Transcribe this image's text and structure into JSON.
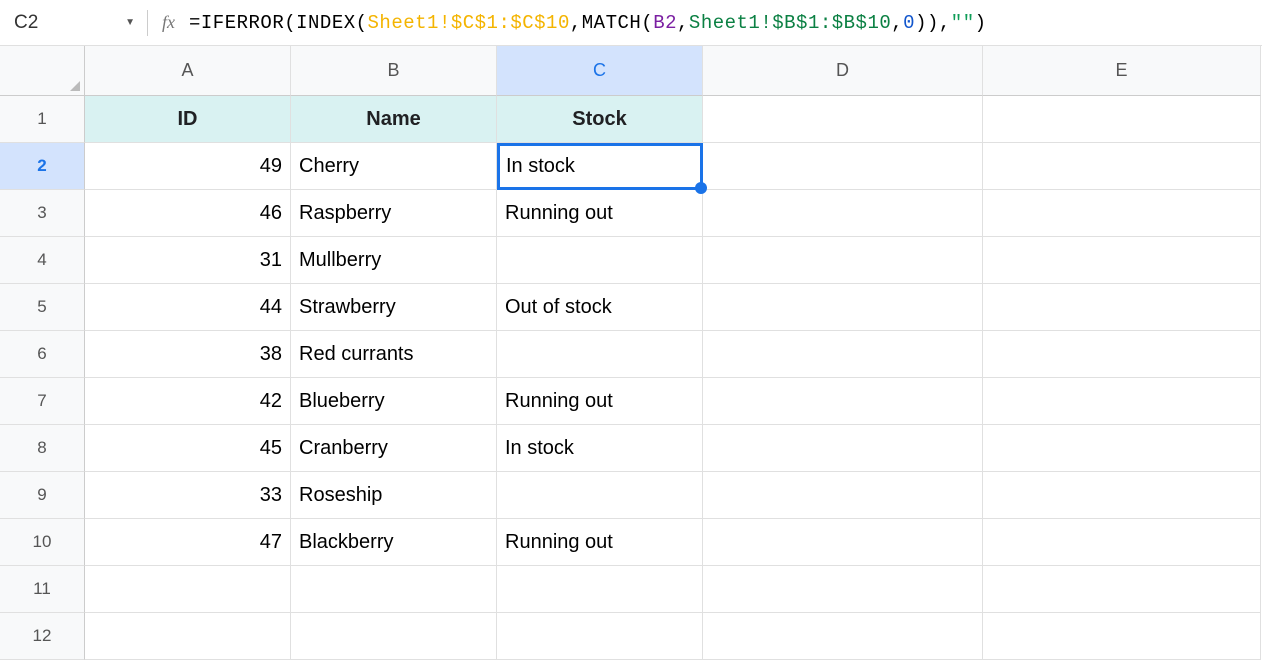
{
  "nameBox": "C2",
  "formula": {
    "prefix": "=IFERROR(INDEX(",
    "range1": "Sheet1!$C$1:$C$10",
    "mid1": ",MATCH(",
    "ref": "B2",
    "mid2": ",",
    "range2": "Sheet1!$B$1:$B$10",
    "mid3": ",",
    "zero": "0",
    "mid4": ")),",
    "quotes": "\"\"",
    "end": ")"
  },
  "columns": [
    "A",
    "B",
    "C",
    "D",
    "E"
  ],
  "selectedColumn": "C",
  "selectedRow": 2,
  "headerRow": [
    "ID",
    "Name",
    "Stock"
  ],
  "rows": [
    {
      "num": 1,
      "A": "ID",
      "B": "Name",
      "C": "Stock",
      "header": true
    },
    {
      "num": 2,
      "A": "49",
      "B": "Cherry",
      "C": "In stock",
      "active": true
    },
    {
      "num": 3,
      "A": "46",
      "B": "Raspberry",
      "C": "Running out"
    },
    {
      "num": 4,
      "A": "31",
      "B": "Mullberry",
      "C": ""
    },
    {
      "num": 5,
      "A": "44",
      "B": "Strawberry",
      "C": "Out of stock"
    },
    {
      "num": 6,
      "A": "38",
      "B": "Red currants",
      "C": ""
    },
    {
      "num": 7,
      "A": "42",
      "B": "Blueberry",
      "C": "Running out"
    },
    {
      "num": 8,
      "A": "45",
      "B": "Cranberry",
      "C": "In stock"
    },
    {
      "num": 9,
      "A": "33",
      "B": "Roseship",
      "C": ""
    },
    {
      "num": 10,
      "A": "47",
      "B": "Blackberry",
      "C": "Running out"
    },
    {
      "num": 11,
      "A": "",
      "B": "",
      "C": ""
    },
    {
      "num": 12,
      "A": "",
      "B": "",
      "C": ""
    }
  ]
}
